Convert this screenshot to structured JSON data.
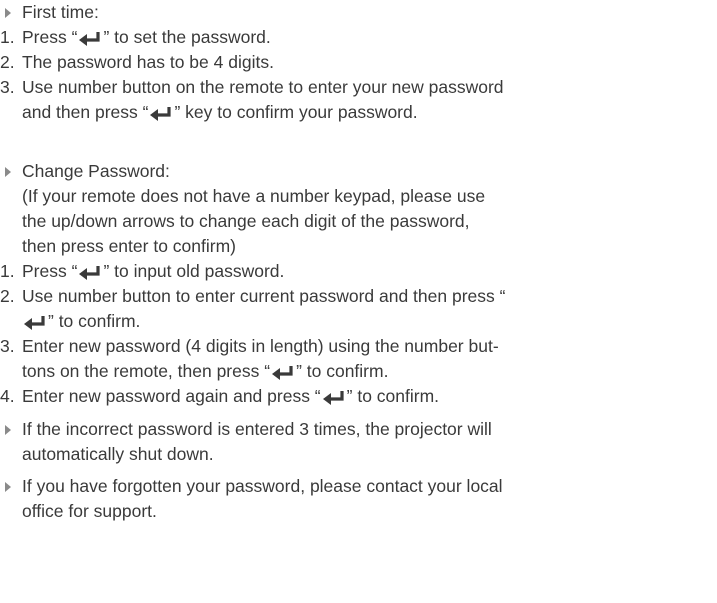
{
  "sections": [
    {
      "bullet": "First time:",
      "steps": [
        {
          "num": "1.",
          "parts": [
            "Press “",
            "” to set the password."
          ]
        },
        {
          "num": "2.",
          "text": "The password has to be 4 digits."
        },
        {
          "num": "3.",
          "line1": "Use number button on the remote to enter your new password",
          "line2_parts": [
            "and then press “",
            "” key to confirm your password."
          ]
        }
      ]
    },
    {
      "bullet": "Change Password:",
      "note_lines": [
        "(If your remote does not have  a number keypad, please  use",
        "the up/down arrows to change each digit of the password,",
        "then press enter to confirm)"
      ],
      "steps": [
        {
          "num": "1.",
          "parts": [
            "Press “",
            "” to input old password."
          ]
        },
        {
          "num": "2.",
          "line1": "Use number button to enter current password and then press “",
          "line2_parts": [
            "",
            "” to confirm."
          ]
        },
        {
          "num": "3.",
          "line1": "Enter new password (4 digits in length) using the number but-",
          "line2_parts": [
            "tons on the remote, then press “",
            "” to confirm."
          ]
        },
        {
          "num": "4.",
          "parts": [
            "Enter new password again and press “",
            "” to confirm."
          ]
        }
      ]
    }
  ],
  "notes": [
    {
      "line1": "If the incorrect password is entered 3 times, the projector will",
      "line2": "automatically shut down."
    },
    {
      "line1": "If you have forgotten your password, please contact your local",
      "line2": "office for support."
    }
  ],
  "icons": {
    "enter": "enter-key-icon",
    "bullet": "triangle-bullet-icon"
  },
  "colors": {
    "text": "#3a3a3a",
    "bullet": "#8a8a8a"
  }
}
